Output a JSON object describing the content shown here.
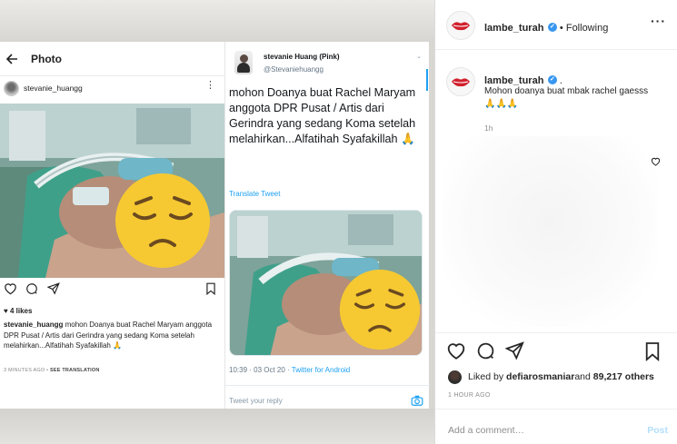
{
  "post_image": {
    "instagram_screenshot": {
      "header_title": "Photo",
      "username": "stevanie_huangg",
      "likes": "4 likes",
      "caption_username": "stevanie_huangg",
      "caption_text": "mohon Doanya buat Rachel Maryam anggota DPR Pusat / Artis dari Gerindra yang sedang Koma setelah melahirkan...Alfatihah Syafakillah 🙏",
      "time": "3 MINUTES AGO",
      "see_translation": "SEE TRANSLATION",
      "separator": " • "
    },
    "twitter_screenshot": {
      "display_name": "stevanie Huang (Pink)",
      "handle": "@Stevaniehuangg",
      "tweet_text": "mohon Doanya buat Rachel Maryam anggota DPR Pusat / Artis dari Gerindra yang sedang Koma setelah melahirkan...Alfatihah Syafakillah 🙏",
      "translate": "Translate Tweet",
      "timestamp": "10:39 · 03 Oct 20 · ",
      "source": "Twitter for Android",
      "reply_placeholder": "Tweet your reply"
    }
  },
  "side_panel": {
    "header": {
      "username": "lambe_turah",
      "verified_glyph": "✓",
      "follow_separator": " • ",
      "follow_state": "Following",
      "more_glyph": "···"
    },
    "caption": {
      "username": "lambe_turah",
      "suffix": " .",
      "text": "Mohon doanya buat mbak rachel gaesss🙏🙏🙏",
      "time": "1h"
    },
    "liked_by": {
      "prefix": "Liked by ",
      "user": "defiarosmaniar",
      "middle": " and ",
      "count": "89,217 others"
    },
    "post_time": "1 HOUR AGO",
    "add_comment_placeholder": "Add a comment…",
    "post_button": "Post"
  },
  "colors": {
    "brand_red": "#d1202d",
    "ig_blue": "#3897f0",
    "twitter_blue": "#1da1f2",
    "post_button_disabled": "#b2dffc",
    "emoji_yellow": "#f6c932"
  },
  "icons": [
    "back-arrow-icon",
    "kebab-icon",
    "heart-icon",
    "comment-icon",
    "share-icon",
    "bookmark-icon",
    "camera-icon",
    "verified-icon",
    "lips-logo-icon",
    "pensive-emoji-icon",
    "chevron-down-icon"
  ]
}
